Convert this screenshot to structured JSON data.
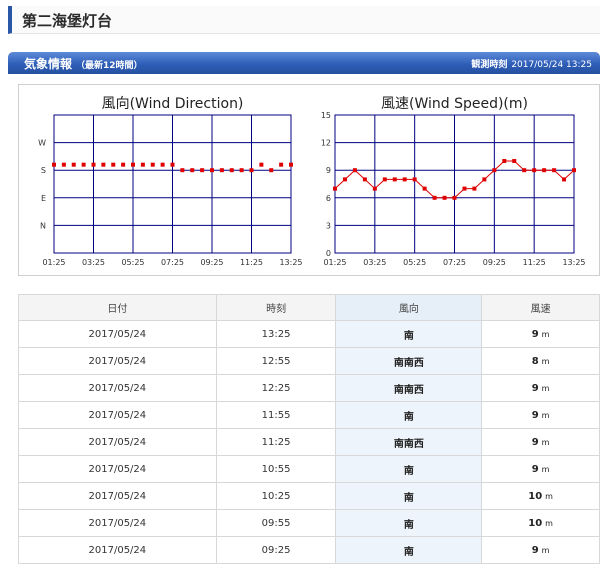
{
  "page": {
    "title": "第二海堡灯台"
  },
  "section": {
    "title": "気象情報",
    "subtitle": "（最新12時間）",
    "time_label": "観測時刻",
    "time_value": "2017/05/24 13:25"
  },
  "chart_data": [
    {
      "type": "scatter",
      "title": "風向(Wind Direction)",
      "x_ticks": [
        "01:25",
        "03:25",
        "05:25",
        "07:25",
        "09:25",
        "11:25",
        "13:25"
      ],
      "y_ticks": [
        "N",
        "E",
        "S",
        "W"
      ],
      "y_range": [
        0,
        4
      ],
      "color": "#e00000",
      "x_count": 25,
      "values": [
        2.2,
        2.2,
        2.2,
        2.2,
        2.2,
        2.2,
        2.2,
        2.2,
        2.2,
        2.2,
        2.2,
        2.2,
        2.2,
        2.0,
        2.0,
        2.0,
        2.0,
        2.0,
        2.0,
        2.0,
        2.0,
        2.2,
        2.0,
        2.2,
        2.2,
        2.0
      ]
    },
    {
      "type": "line",
      "title": "風速(Wind Speed)(m)",
      "x_ticks": [
        "01:25",
        "03:25",
        "05:25",
        "07:25",
        "09:25",
        "11:25",
        "13:25"
      ],
      "y_ticks": [
        "0",
        "3",
        "6",
        "9",
        "12",
        "15"
      ],
      "y_range": [
        0,
        15
      ],
      "color": "#e00000",
      "x_count": 25,
      "values": [
        7,
        8,
        9,
        8,
        7,
        8,
        8,
        8,
        8,
        7,
        6,
        6,
        6,
        7,
        7,
        8,
        9,
        10,
        10,
        9,
        9,
        9,
        9,
        8,
        9
      ]
    }
  ],
  "table": {
    "headers": [
      "日付",
      "時刻",
      "風向",
      "風速"
    ],
    "unit": "m",
    "rows": [
      {
        "date": "2017/05/24",
        "time": "13:25",
        "dir": "南",
        "speed": "9"
      },
      {
        "date": "2017/05/24",
        "time": "12:55",
        "dir": "南南西",
        "speed": "8"
      },
      {
        "date": "2017/05/24",
        "time": "12:25",
        "dir": "南南西",
        "speed": "9"
      },
      {
        "date": "2017/05/24",
        "time": "11:55",
        "dir": "南",
        "speed": "9"
      },
      {
        "date": "2017/05/24",
        "time": "11:25",
        "dir": "南南西",
        "speed": "9"
      },
      {
        "date": "2017/05/24",
        "time": "10:55",
        "dir": "南",
        "speed": "9"
      },
      {
        "date": "2017/05/24",
        "time": "10:25",
        "dir": "南",
        "speed": "10"
      },
      {
        "date": "2017/05/24",
        "time": "09:55",
        "dir": "南",
        "speed": "10"
      },
      {
        "date": "2017/05/24",
        "time": "09:25",
        "dir": "南",
        "speed": "9"
      }
    ]
  }
}
